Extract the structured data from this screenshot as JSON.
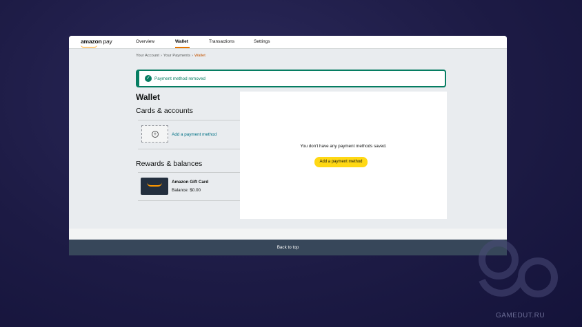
{
  "header": {
    "logo_main": "amazon",
    "logo_sub": "pay",
    "tabs": [
      {
        "label": "Overview"
      },
      {
        "label": "Wallet"
      },
      {
        "label": "Transactions"
      },
      {
        "label": "Settings"
      }
    ],
    "active_tab": "Wallet"
  },
  "breadcrumb": {
    "items": [
      "Your Account",
      "Your Payments",
      "Wallet"
    ],
    "separator": "›"
  },
  "alert": {
    "message": "Payment method removed",
    "icon": "check-circle-icon",
    "color": "#067d62"
  },
  "wallet": {
    "title": "Wallet",
    "cards_heading": "Cards & accounts",
    "add_method_label": "Add a payment method",
    "rewards_heading": "Rewards & balances",
    "gift_card": {
      "name": "Amazon Gift Card",
      "balance": "Balance: $0.00"
    }
  },
  "main_panel": {
    "empty_message": "You don't have any payment methods saved.",
    "add_button_label": "Add a payment method",
    "button_color": "#ffd814"
  },
  "footer": {
    "back_to_top": "Back to top"
  },
  "watermark": {
    "text": "GAMEDUT.RU"
  },
  "colors": {
    "accent": "#e77600",
    "link": "#007185",
    "footer_dark": "#37475a",
    "breadcrumb_current": "#c45500"
  }
}
